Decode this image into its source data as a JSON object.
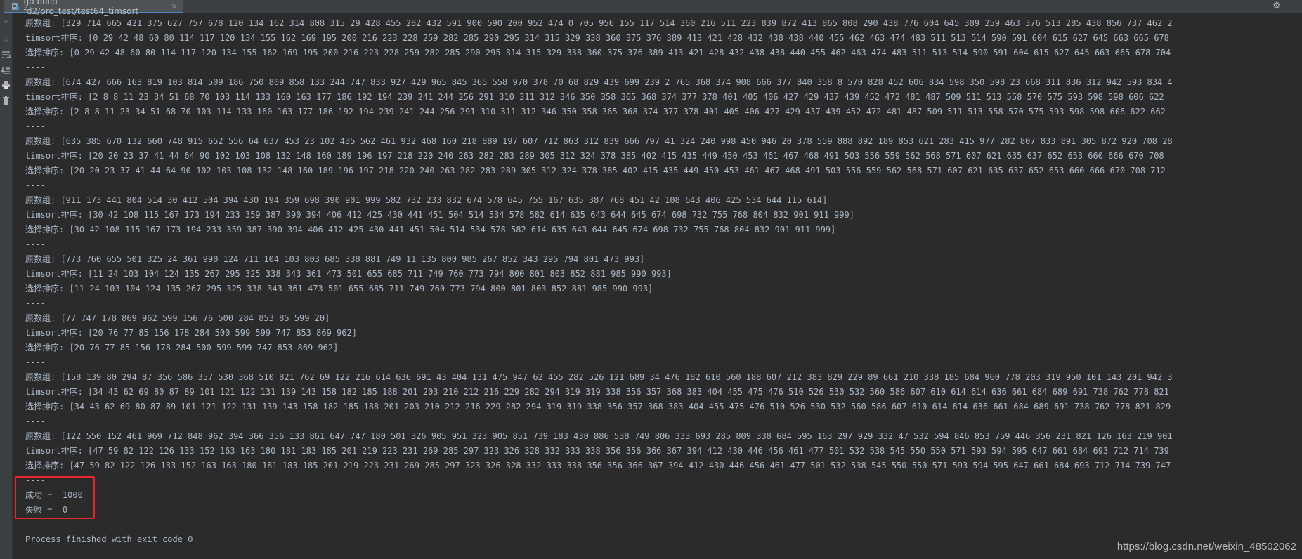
{
  "tab": {
    "title": "go build fd2/pro_test/test64_timsort",
    "close": "×",
    "icon": "go-file-icon"
  },
  "toolbar_right": {
    "settings": "⚙",
    "minimize": "–"
  },
  "sidebar": {
    "icons": [
      "up-arrow-icon",
      "down-arrow-icon",
      "soft-wrap-icon",
      "scroll-to-end-icon",
      "print-icon",
      "trash-icon"
    ]
  },
  "console_lines": [
    "原数组: [329 714 665 421 375 627 757 678 120 134 162 314 808 315 29 428 455 282 432 591 900 590 200 952 474 0 705 956 155 117 514 360 216 511 223 839 872 413 865 808 290 438 776 604 645 389 259 463 376 513 285 438 856 737 462 2",
    "timsort排序: [0 29 42 48 60 80 114 117 120 134 155 162 169 195 200 216 223 228 259 282 285 290 295 314 315 329 338 360 375 376 389 413 421 428 432 438 438 440 455 462 463 474 483 511 513 514 590 591 604 615 627 645 663 665 678",
    "选择排序: [0 29 42 48 60 80 114 117 120 134 155 162 169 195 200 216 223 228 259 282 285 290 295 314 315 329 338 360 375 376 389 413 421 428 432 438 438 440 455 462 463 474 483 511 513 514 590 591 604 615 627 645 663 665 678 704",
    "----",
    "原数组: [674 427 666 163 819 103 814 509 186 750 809 858 133 244 747 833 927 429 965 845 365 558 970 378 70 68 829 439 699 239 2 765 368 374 908 666 377 840 358 8 570 828 452 606 834 598 350 598 23 668 311 836 312 942 593 834 4",
    "timsort排序: [2 8 8 11 23 34 51 68 70 103 114 133 160 163 177 186 192 194 239 241 244 256 291 310 311 312 346 350 358 365 368 374 377 378 401 405 406 427 429 437 439 452 472 481 487 509 511 513 558 570 575 593 598 598 606 622",
    "选择排序: [2 8 8 11 23 34 51 68 70 103 114 133 160 163 177 186 192 194 239 241 244 256 291 310 311 312 346 350 358 365 368 374 377 378 401 405 406 427 429 437 439 452 472 481 487 509 511 513 558 570 575 593 598 598 606 622 662",
    "----",
    "原数组: [635 385 670 132 660 748 915 652 556 64 637 453 23 102 435 562 461 932 468 160 218 889 197 607 712 863 312 839 666 797 41 324 240 998 450 946 20 378 559 888 892 189 853 621 283 415 977 282 807 833 891 305 872 920 708 28",
    "timsort排序: [20 20 23 37 41 44 64 90 102 103 108 132 148 160 189 196 197 218 220 240 263 282 283 289 305 312 324 378 385 402 415 435 449 450 453 461 467 468 491 503 556 559 562 568 571 607 621 635 637 652 653 660 666 670 708",
    "选择排序: [20 20 23 37 41 44 64 90 102 103 108 132 148 160 189 196 197 218 220 240 263 282 283 289 305 312 324 378 385 402 415 435 449 450 453 461 467 468 491 503 556 559 562 568 571 607 621 635 637 652 653 660 666 670 708 712",
    "----",
    "原数组: [911 173 441 804 514 30 412 504 394 430 194 359 698 390 901 999 582 732 233 832 674 578 645 755 167 635 387 768 451 42 108 643 406 425 534 644 115 614]",
    "timsort排序: [30 42 108 115 167 173 194 233 359 387 390 394 406 412 425 430 441 451 504 514 534 578 582 614 635 643 644 645 674 698 732 755 768 804 832 901 911 999]",
    "选择排序: [30 42 108 115 167 173 194 233 359 387 390 394 406 412 425 430 441 451 504 514 534 578 582 614 635 643 644 645 674 698 732 755 768 804 832 901 911 999]",
    "----",
    "原数组: [773 760 655 501 325 24 361 990 124 711 104 103 803 685 338 881 749 11 135 800 985 267 852 343 295 794 801 473 993]",
    "timsort排序: [11 24 103 104 124 135 267 295 325 338 343 361 473 501 655 685 711 749 760 773 794 800 801 803 852 881 985 990 993]",
    "选择排序: [11 24 103 104 124 135 267 295 325 338 343 361 473 501 655 685 711 749 760 773 794 800 801 803 852 881 985 990 993]",
    "----",
    "原数组: [77 747 178 869 962 599 156 76 500 284 853 85 599 20]",
    "timsort排序: [20 76 77 85 156 178 284 500 599 599 747 853 869 962]",
    "选择排序: [20 76 77 85 156 178 284 500 599 599 747 853 869 962]",
    "----",
    "原数组: [158 139 80 294 87 356 586 357 530 368 510 821 762 69 122 216 614 636 691 43 404 131 475 947 62 455 282 526 121 689 34 476 182 610 560 188 607 212 383 829 229 89 661 210 338 185 684 960 778 203 319 950 101 143 201 942 3",
    "timsort排序: [34 43 62 69 80 87 89 101 121 122 131 139 143 158 182 185 188 201 203 210 212 216 229 282 294 319 319 338 356 357 368 383 404 455 475 476 510 526 530 532 560 586 607 610 614 614 636 661 684 689 691 738 762 778 821",
    "选择排序: [34 43 62 69 80 87 89 101 121 122 131 139 143 158 182 185 188 201 203 210 212 216 229 282 294 319 319 338 356 357 368 383 404 455 475 476 510 526 530 532 560 586 607 610 614 614 636 661 684 689 691 738 762 778 821 829",
    "----",
    "原数组: [122 550 152 461 969 712 848 962 394 366 356 133 861 647 747 180 501 326 905 951 323 905 851 739 183 430 886 538 749 806 333 693 285 809 338 684 595 163 297 929 332 47 532 594 846 853 759 446 356 231 821 126 163 219 901",
    "timsort排序: [47 59 82 122 126 133 152 163 163 180 181 183 185 201 219 223 231 269 285 297 323 326 328 332 333 338 356 356 366 367 394 412 430 446 456 461 477 501 532 538 545 550 550 571 593 594 595 647 661 684 693 712 714 739",
    "选择排序: [47 59 82 122 126 133 152 163 163 180 181 183 185 201 219 223 231 269 285 297 323 326 328 332 333 338 356 356 366 367 394 412 430 446 456 461 477 501 532 538 545 550 550 571 593 594 595 647 661 684 693 712 714 739 747",
    "----",
    "成功 =  1000",
    "失败 =  0",
    "",
    "Process finished with exit code 0"
  ],
  "watermark": "https://blog.csdn.net/weixin_48502062"
}
